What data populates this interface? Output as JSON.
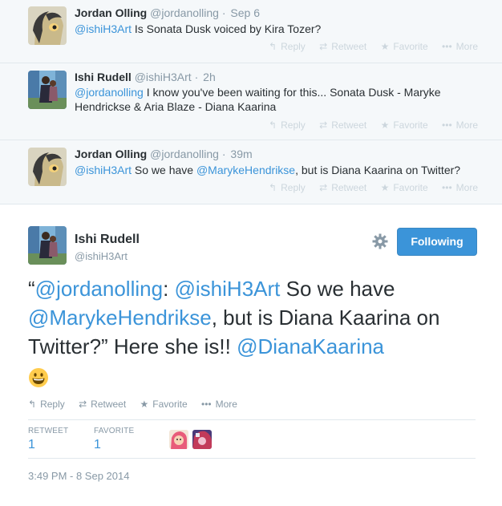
{
  "replies": [
    {
      "name": "Jordan Olling",
      "handle": "@jordanolling",
      "sep": "·",
      "time": "Sep 6",
      "mention": "@ishiH3Art",
      "text": " Is Sonata Dusk voiced by Kira Tozer?",
      "text2": ""
    },
    {
      "name": "Ishi Rudell",
      "handle": "@ishiH3Art",
      "sep": "·",
      "time": "2h",
      "mention": "@jordanolling",
      "text": " I know you've been waiting for this... Sonata Dusk - Maryke",
      "text2": "Hendrickse & Aria Blaze - Diana Kaarina"
    },
    {
      "name": "Jordan Olling",
      "handle": "@jordanolling",
      "sep": "·",
      "time": "39m",
      "mention": "@ishiH3Art",
      "text": " So we have ",
      "mention2": "@MarykeHendrikse",
      "text2": ", but is Diana Kaarina on Twitter?"
    }
  ],
  "actions": {
    "reply": "Reply",
    "retweet": "Retweet",
    "favorite": "Favorite",
    "more": "More"
  },
  "main": {
    "name": "Ishi Rudell",
    "handle": "@ishiH3Art",
    "follow_label": "Following",
    "quote_open": "“",
    "m1": "@jordanolling",
    "colon": ": ",
    "m2": "@ishiH3Art",
    "t1": " So we have ",
    "m3": "@MarykeHendrikse",
    "t2": ", but is Diana Kaarina on Twitter?” Here she is!! ",
    "m4": "@DianaKaarina",
    "retweet_label": "RETWEET",
    "retweet_count": "1",
    "favorite_label": "FAVORITE",
    "favorite_count": "1",
    "timestamp": "3:49 PM - 8 Sep 2014"
  },
  "colors": {
    "link": "#3b94d9",
    "follow_bg": "#3b94d9",
    "reply_bg": "#f5f8fa"
  }
}
